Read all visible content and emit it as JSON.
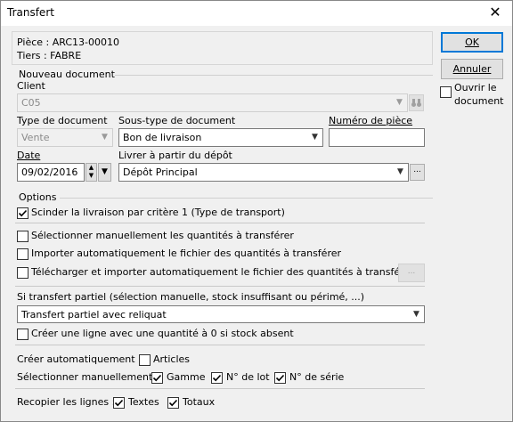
{
  "window": {
    "title": "Transfert",
    "close_glyph": "✕"
  },
  "info": {
    "piece": "Pièce : ARC13-00010",
    "tiers": "Tiers : FABRE"
  },
  "buttons": {
    "ok": "OK",
    "annuler": "Annuler"
  },
  "ouvrir": {
    "label_line1": "Ouvrir le",
    "label_line2": "document",
    "checked": false
  },
  "nouveau": {
    "legend": "Nouveau document",
    "client_label": "Client",
    "client_value": "C05",
    "type_label": "Type de document",
    "type_value": "Vente",
    "soustype_label": "Sous-type de document",
    "soustype_value": "Bon de livraison",
    "numero_label": "Numéro de pièce",
    "numero_value": "",
    "date_label": "Date",
    "date_value": "09/02/2016",
    "depot_label": "Livrer à partir du dépôt",
    "depot_value": "Dépôt Principal"
  },
  "options": {
    "legend": "Options",
    "scinder": "Scinder la livraison par critère 1 (Type de transport)",
    "selectionner": "Sélectionner manuellement les quantités à transférer",
    "importer": "Importer automatiquement le fichier des quantités à transférer",
    "telecharger": "Télécharger et importer automatiquement le fichier des quantités à transférer",
    "partiel_label": "Si transfert partiel (sélection manuelle, stock insuffisant ou périmé, ...)",
    "partiel_value": "Transfert partiel avec reliquat",
    "creer_ligne": "Créer une ligne avec une quantité à 0 si stock absent",
    "creer_auto_label": "Créer automatiquement :",
    "articles": "Articles",
    "select_manu_label": "Sélectionner manuellement :",
    "gamme": "Gamme",
    "lot": "N° de lot",
    "serie": "N° de série",
    "recopier_label": "Recopier les lignes :",
    "textes": "Textes",
    "totaux": "Totaux"
  },
  "ellipsis": "..."
}
